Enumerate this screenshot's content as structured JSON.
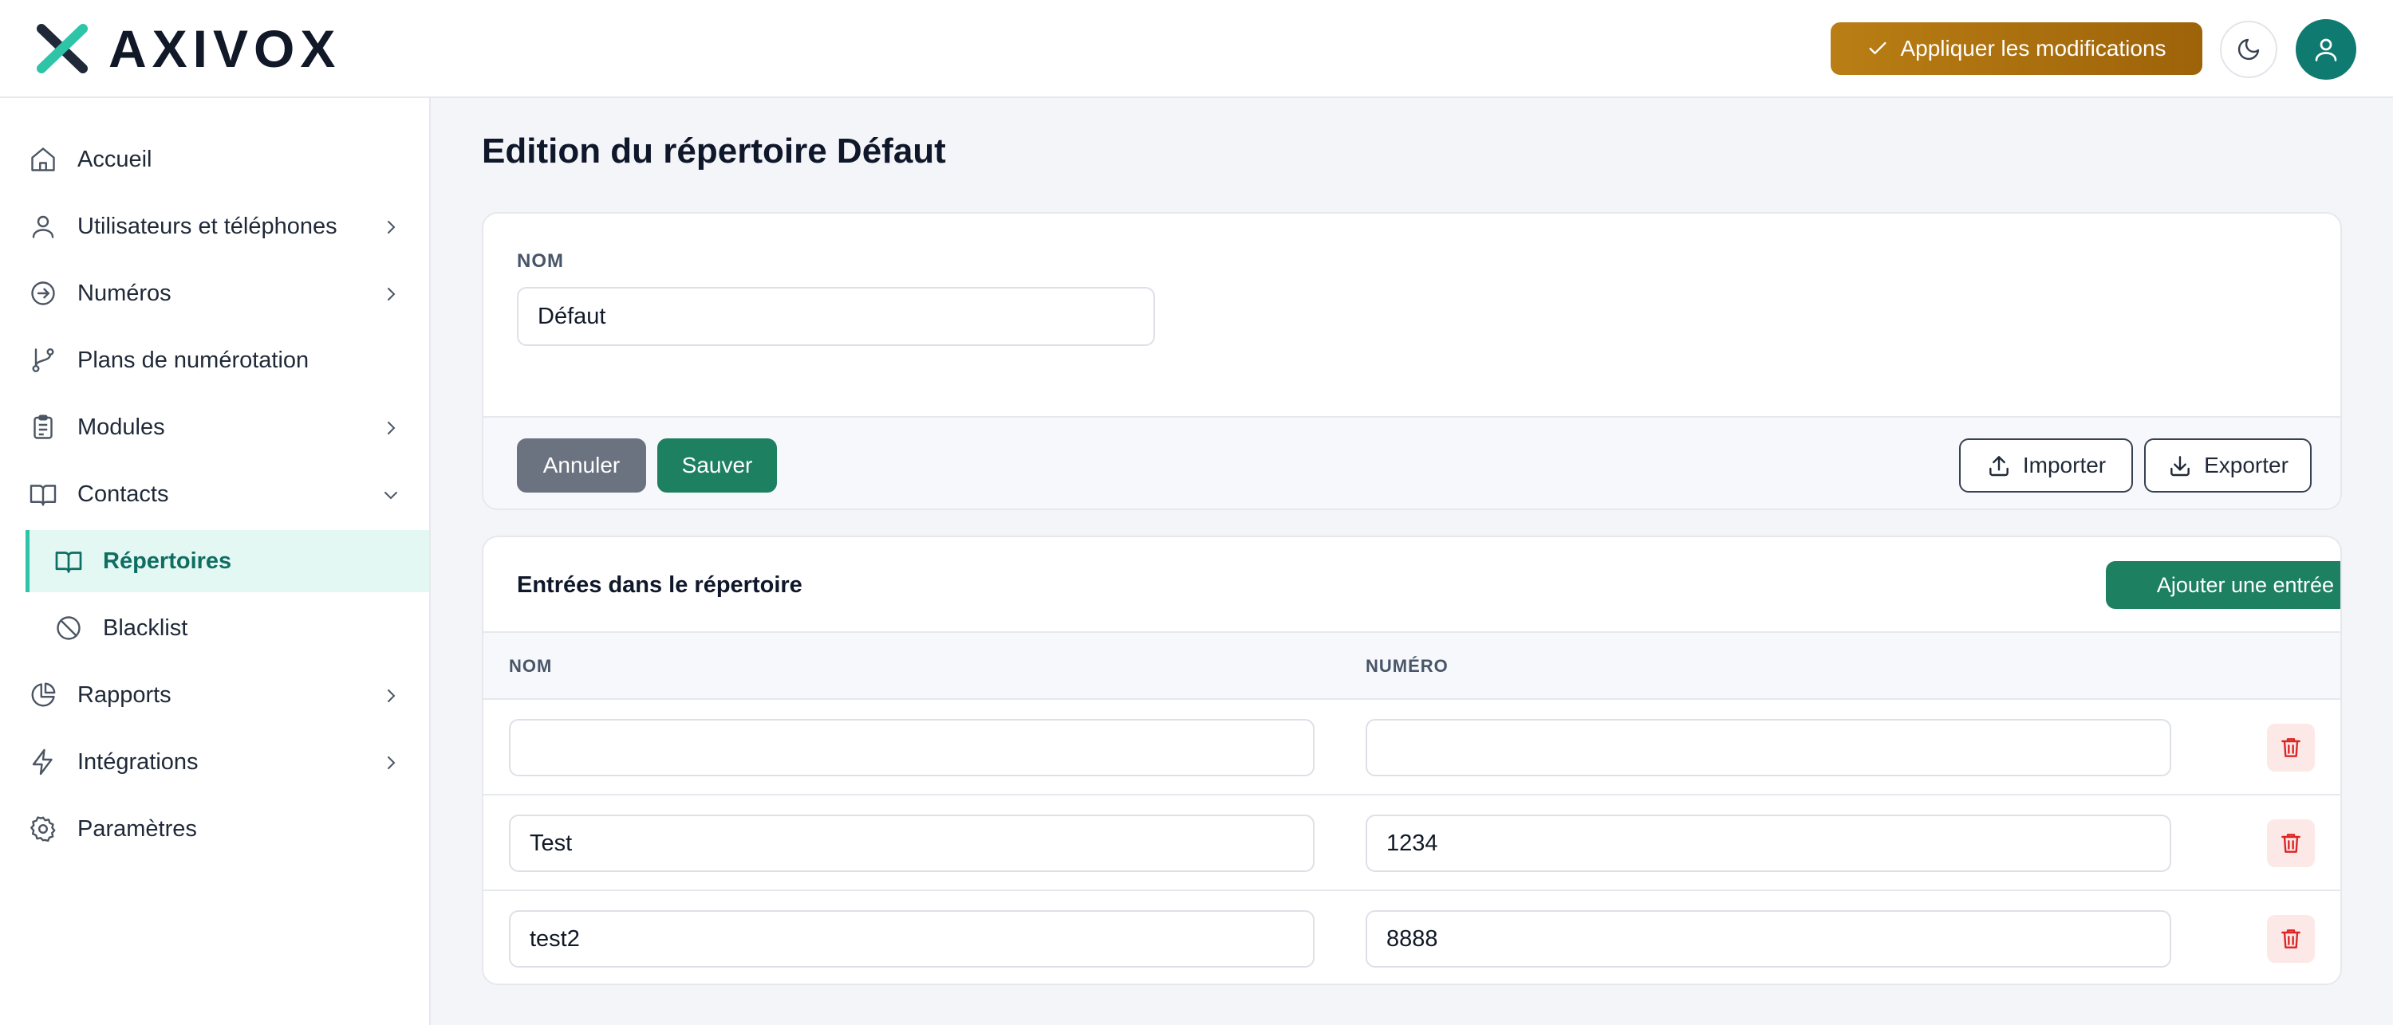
{
  "header": {
    "brand": "AXIVOX",
    "apply_label": "Appliquer les modifications",
    "accent": "#b07310",
    "brand_color": "#0f7a6f"
  },
  "sidebar": {
    "items": [
      {
        "label": "Accueil",
        "icon": "home-icon",
        "chevron": "none"
      },
      {
        "label": "Utilisateurs et téléphones",
        "icon": "user-icon",
        "chevron": "right"
      },
      {
        "label": "Numéros",
        "icon": "arrow-circle-icon",
        "chevron": "right"
      },
      {
        "label": "Plans de numérotation",
        "icon": "git-branch-icon",
        "chevron": "none"
      },
      {
        "label": "Modules",
        "icon": "clipboard-icon",
        "chevron": "right"
      },
      {
        "label": "Contacts",
        "icon": "book-icon",
        "chevron": "down"
      },
      {
        "label": "Répertoires",
        "icon": "book-open-icon",
        "chevron": "none",
        "active": true
      },
      {
        "label": "Blacklist",
        "icon": "ban-icon",
        "chevron": "none"
      },
      {
        "label": "Rapports",
        "icon": "pie-chart-icon",
        "chevron": "right"
      },
      {
        "label": "Intégrations",
        "icon": "lightning-icon",
        "chevron": "right"
      },
      {
        "label": "Paramètres",
        "icon": "gear-icon",
        "chevron": "none"
      }
    ]
  },
  "main": {
    "title": "Edition du répertoire Défaut",
    "form": {
      "name_label": "NOM",
      "name_value": "Défaut",
      "cancel_label": "Annuler",
      "save_label": "Sauver",
      "import_label": "Importer",
      "export_label": "Exporter"
    },
    "entries": {
      "title": "Entrées dans le répertoire",
      "add_label": "Ajouter une entrée",
      "columns": [
        "NOM",
        "NUMÉRO"
      ],
      "rows": [
        {
          "name": "",
          "number": ""
        },
        {
          "name": "Test",
          "number": "1234"
        },
        {
          "name": "test2",
          "number": "8888"
        }
      ]
    }
  }
}
